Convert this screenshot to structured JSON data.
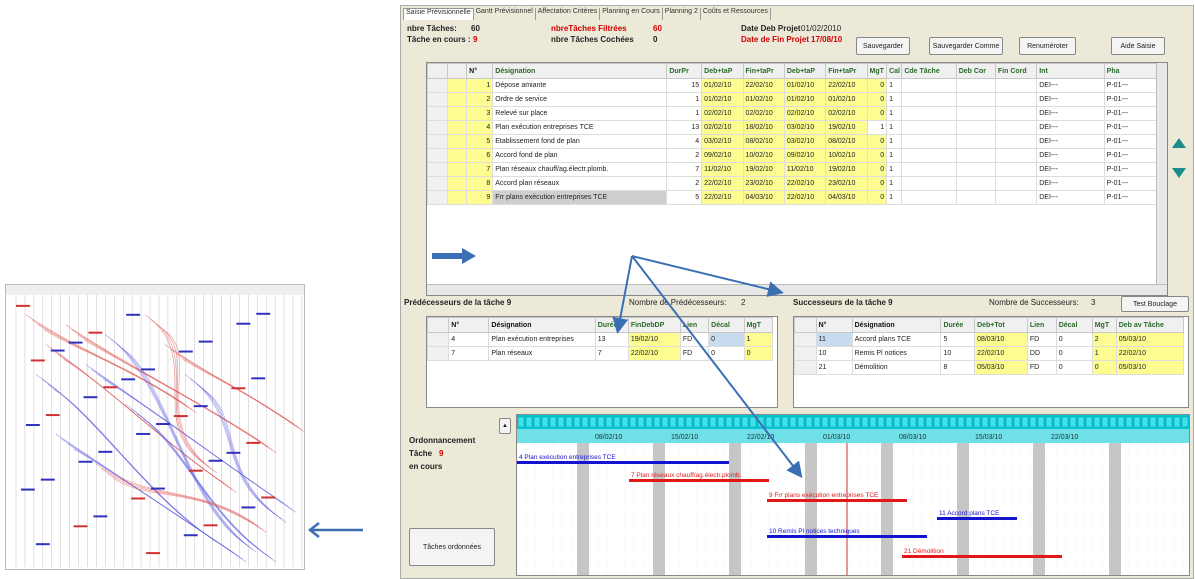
{
  "tabs": [
    "Saisie Prévisionnelle",
    "Gantt Prévisionnel",
    "Affectation Critères",
    "Planning en Cours",
    "Planning 2",
    "Coûts et Ressources"
  ],
  "header": {
    "nbre_taches_label": "nbre Tâches:",
    "nbre_taches_value": "60",
    "nbre_filtrees_label": "nbreTâches Filtrées",
    "nbre_filtrees_value": "60",
    "date_deb_label": "Date Deb Projet",
    "date_deb_value": "01/02/2010",
    "tache_en_cours_label": "Tâche en cours :",
    "tache_en_cours_value": "9",
    "nbre_cochees_label": "nbre Tâches Cochées",
    "nbre_cochees_value": "0",
    "date_fin_label": "Date de Fin Projet",
    "date_fin_value": "17/08/10"
  },
  "buttons": {
    "save": "Sauvegarder",
    "save_as": "Sauvegarder Comme",
    "renumber": "Renuméroter",
    "help": "Aide Saisie",
    "test_bouclage": "Test Bouclage",
    "taches_ordonnees": "Tâches ordonnées"
  },
  "main_grid": {
    "columns": [
      "N°",
      "Désignation",
      "DurPr",
      "Deb+taP",
      "Fin+taPr",
      "Deb+taP",
      "Fin+taPr",
      "MgT",
      "Cal",
      "Cde Tâche",
      "Deb Cor",
      "Fin Cord",
      "Int",
      "Pha"
    ],
    "rows": [
      [
        "1",
        "Dépose amiante",
        "15",
        "01/02/10",
        "22/02/10",
        "01/02/10",
        "22/02/10",
        "0",
        "1",
        "",
        "",
        "",
        "DEI---",
        "P-01---"
      ],
      [
        "2",
        "Ordre de service",
        "1",
        "01/02/10",
        "01/02/10",
        "01/02/10",
        "01/02/10",
        "0",
        "1",
        "",
        "",
        "",
        "DEI---",
        "P-01---"
      ],
      [
        "3",
        "Relevé sur place",
        "1",
        "02/02/10",
        "02/02/10",
        "02/02/10",
        "02/02/10",
        "0",
        "1",
        "",
        "",
        "",
        "DEI---",
        "P-01---"
      ],
      [
        "4",
        "Plan exécution entreprises TCE",
        "13",
        "02/02/10",
        "18/02/10",
        "03/02/10",
        "19/02/10",
        "1",
        "1",
        "",
        "",
        "",
        "DEI---",
        "P-01---"
      ],
      [
        "5",
        "Etablissement fond de plan",
        "4",
        "03/02/10",
        "08/02/10",
        "03/02/10",
        "08/02/10",
        "0",
        "1",
        "",
        "",
        "",
        "DEI---",
        "P-01---"
      ],
      [
        "6",
        "Accord fond de plan",
        "2",
        "09/02/10",
        "10/02/10",
        "09/02/10",
        "10/02/10",
        "0",
        "1",
        "",
        "",
        "",
        "DEI---",
        "P-01---"
      ],
      [
        "7",
        "Plan réseaux chauff/ag.électr.plomb.",
        "7",
        "11/02/10",
        "19/02/10",
        "11/02/10",
        "19/02/10",
        "0",
        "1",
        "",
        "",
        "",
        "DEI---",
        "P-01---"
      ],
      [
        "8",
        "Accord plan réseaux",
        "2",
        "22/02/10",
        "23/02/10",
        "22/02/10",
        "23/02/10",
        "0",
        "1",
        "",
        "",
        "",
        "DEI---",
        "P-01---"
      ],
      [
        "9",
        "Frr plans exécution entreprises TCE",
        "5",
        "22/02/10",
        "04/03/10",
        "22/02/10",
        "04/03/10",
        "0",
        "1",
        "",
        "",
        "",
        "DEI---",
        "P-01---"
      ]
    ]
  },
  "pred": {
    "title": "Prédécesseurs de la tâche 9",
    "count_label": "Nombre de Prédécesseurs:",
    "count": "2",
    "columns": [
      "N°",
      "Désignation",
      "Durée",
      "FinDebDP",
      "Lien",
      "Décal",
      "MgT"
    ],
    "rows": [
      [
        "4",
        "Plan exécution entreprises",
        "13",
        "19/02/10",
        "FD",
        "0",
        "1"
      ],
      [
        "7",
        "Plan réseaux",
        "7",
        "22/02/10",
        "FD",
        "0",
        "0"
      ]
    ]
  },
  "succ": {
    "title": "Successeurs de la tâche 9",
    "count_label": "Nombre de Successeurs:",
    "count": "3",
    "columns": [
      "N°",
      "Désignation",
      "Durée",
      "Deb+Tot",
      "Lien",
      "Décal",
      "MgT",
      "Deb av Tâche"
    ],
    "rows": [
      [
        "11",
        "Accord plans TCE",
        "5",
        "08/03/10",
        "FD",
        "0",
        "2",
        "05/03/10"
      ],
      [
        "10",
        "Remis Pl notices",
        "10",
        "22/02/10",
        "DD",
        "0",
        "1",
        "22/02/10"
      ],
      [
        "21",
        "Démolition",
        "8",
        "05/03/10",
        "FD",
        "0",
        "0",
        "05/03/10"
      ]
    ]
  },
  "gantt": {
    "label_ordo": "Ordonnancement",
    "label_tache": "Tâche",
    "label_tache_num": "9",
    "label_en_cours": "en cours",
    "dates": [
      "08/02/10",
      "15/02/10",
      "22/02/10",
      "01/03/10",
      "08/03/10",
      "15/03/10",
      "22/03/10"
    ],
    "bar_labels": [
      "4 Plan exécution entreprises TCE",
      "7 Plan réseaux chauff/ag.électr.plomb.",
      "9 Frr plans exécution entreprises TCE",
      "10 Remis Pl notices techniques",
      "11 Accord plans TCE",
      "21 Démolition"
    ]
  },
  "colors": {
    "yellow": "#fcfc90",
    "teal": "#00c8d8",
    "blue_bar": "#1414d0",
    "red_bar": "#e01818",
    "arrow": "#3a6fb4"
  }
}
